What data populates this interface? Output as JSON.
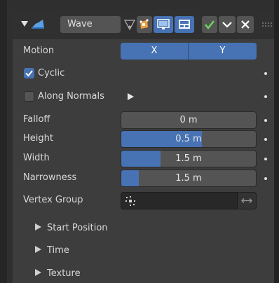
{
  "modifier": {
    "name": "Wave",
    "icon": "wave-modifier-icon"
  },
  "header_icons": [
    "vertex-filter-icon",
    "edit-mode-icon",
    "realtime-display-icon",
    "render-icon",
    "apply-check-icon",
    "dropdown-chevron-icon",
    "remove-x-icon",
    "drag-grip-icon"
  ],
  "motion": {
    "label": "Motion",
    "x": "X",
    "y": "Y"
  },
  "cyclic": {
    "label": "Cyclic",
    "checked": true
  },
  "along_normals": {
    "label": "Along Normals",
    "checked": false
  },
  "falloff": {
    "label": "Falloff",
    "value": "0 m",
    "fill": 0
  },
  "height": {
    "label": "Height",
    "value": "0.5 m",
    "fill": 0.6
  },
  "width": {
    "label": "Width",
    "value": "1.5 m",
    "fill": 0.29
  },
  "narrowness": {
    "label": "Narrowness",
    "value": "1.5 m",
    "fill": 0.13
  },
  "vertex_group": {
    "label": "Vertex Group",
    "value": ""
  },
  "subpanels": [
    {
      "label": "Start Position"
    },
    {
      "label": "Time"
    },
    {
      "label": "Texture"
    }
  ],
  "colors": {
    "accent": "#4772b3",
    "panel": "#3d3d3d",
    "header": "#303030"
  }
}
